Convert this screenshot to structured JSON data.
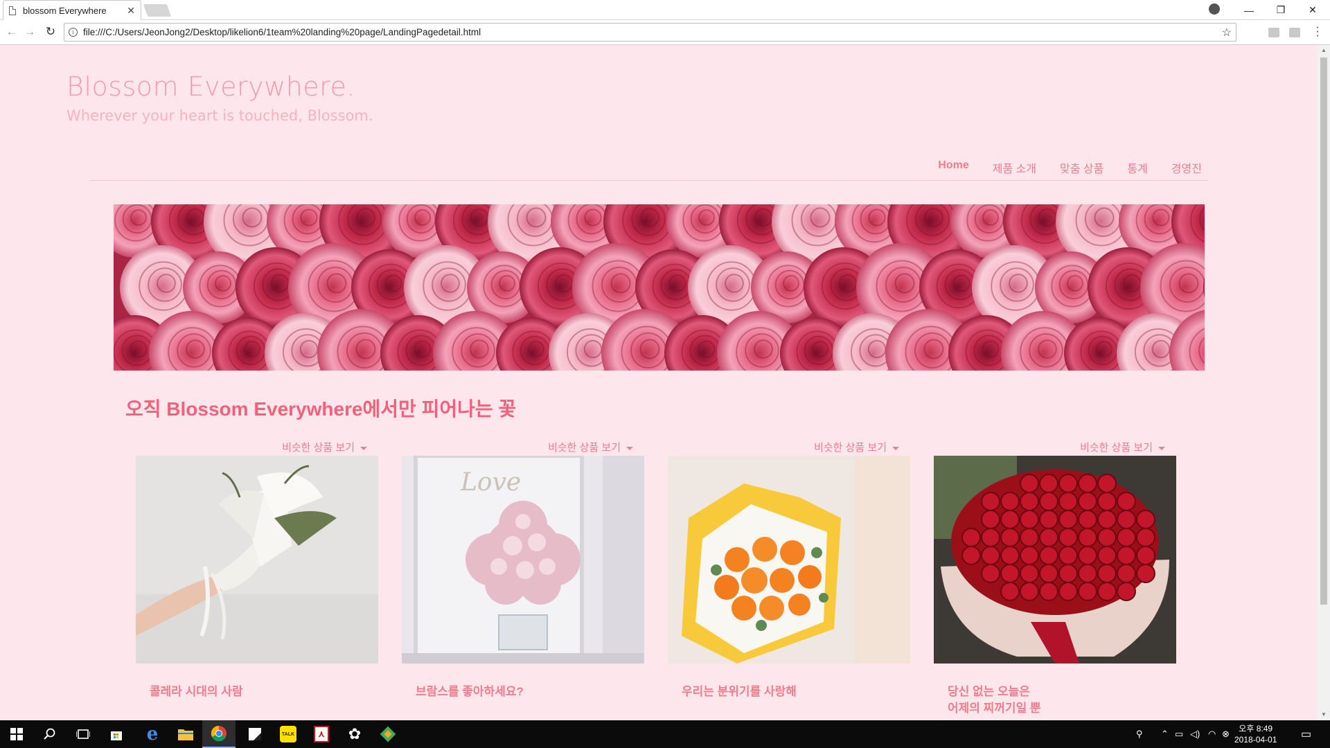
{
  "browser": {
    "tab_title": "blossom Everywhere",
    "tab_close": "✕",
    "url": "file:///C:/Users/JeonJong2/Desktop/likelion6/1team%20landing%20page/LandingPagedetail.html",
    "back": "←",
    "forward": "→",
    "reload": "↻",
    "star": "☆",
    "window_controls": {
      "minimize": "—",
      "restore": "❐",
      "close": "✕"
    }
  },
  "site": {
    "brand": "Blossom Everywhere.",
    "tagline": "Wherever your heart is touched, Blossom.",
    "nav": [
      {
        "label": "Home",
        "active": true
      },
      {
        "label": "제품 소개"
      },
      {
        "label": "맞춤 상품"
      },
      {
        "label": "통계"
      },
      {
        "label": "경영진"
      }
    ],
    "section_heading": "오직 Blossom Everywhere에서만 피어나는 꽃",
    "products": [
      {
        "dropdown": "비슷한 상품 보기",
        "caption_lines": [
          "콜레라 시대의 사람"
        ],
        "image": "white-calla-lily-bouquet"
      },
      {
        "dropdown": "비슷한 상품 보기",
        "caption_lines": [
          "브람스를 좋아하세요?"
        ],
        "image": "pink-hydrangea-vase"
      },
      {
        "dropdown": "비슷한 상품 보기",
        "caption_lines": [
          "우리는 분위기를 사랑해"
        ],
        "image": "orange-rose-bouquet"
      },
      {
        "dropdown": "비슷한 상품 보기",
        "caption_lines": [
          "당신 없는 오늘은",
          "어제의 찌꺼기일 뿐"
        ],
        "image": "red-rose-bouquet"
      }
    ]
  },
  "taskbar": {
    "clock_time": "오후 8:49",
    "clock_date": "2018-04-01",
    "pinned": [
      "windows-start-icon",
      "search-icon",
      "task-view-icon",
      "store-icon",
      "edge-icon",
      "file-explorer-icon",
      "chrome-icon",
      "sticky-notes-icon",
      "kakaotalk-icon",
      "acrobat-icon",
      "gear-app-icon",
      "git-app-icon"
    ],
    "kakaotalk_label": "TALK"
  },
  "colors": {
    "page_bg": "#fde7ed",
    "accent": "#f07c8c",
    "heading": "#f2607a",
    "brand": "#f59aa8"
  }
}
